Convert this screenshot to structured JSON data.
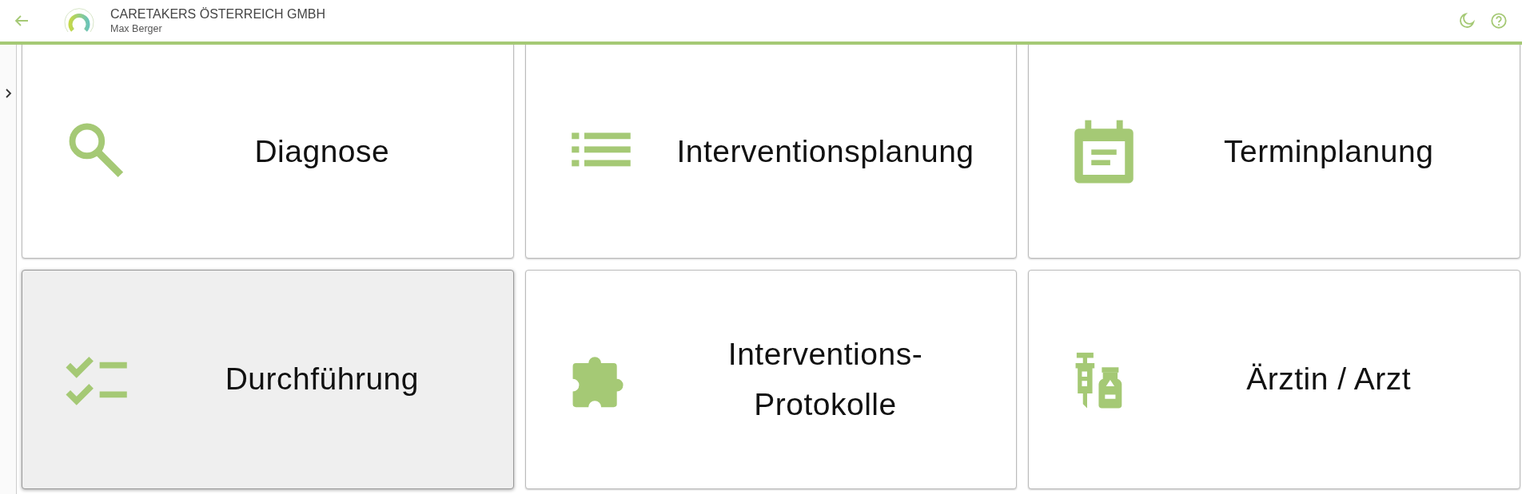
{
  "header": {
    "company": "CARETAKERS ÖSTERREICH GMBH",
    "user": "Max Berger"
  },
  "tiles": [
    {
      "kind": "search",
      "label": "Diagnose",
      "hovered": false
    },
    {
      "kind": "list",
      "label": "Interventionsplanung",
      "hovered": false
    },
    {
      "kind": "calendar",
      "label": "Terminplanung",
      "hovered": false
    },
    {
      "kind": "checklist",
      "label": "Durchführung",
      "hovered": true
    },
    {
      "kind": "puzzle",
      "label": "Interventions-\nProtokolle",
      "hovered": false
    },
    {
      "kind": "vaccine",
      "label": "Ärztin / Arzt",
      "hovered": false
    }
  ]
}
